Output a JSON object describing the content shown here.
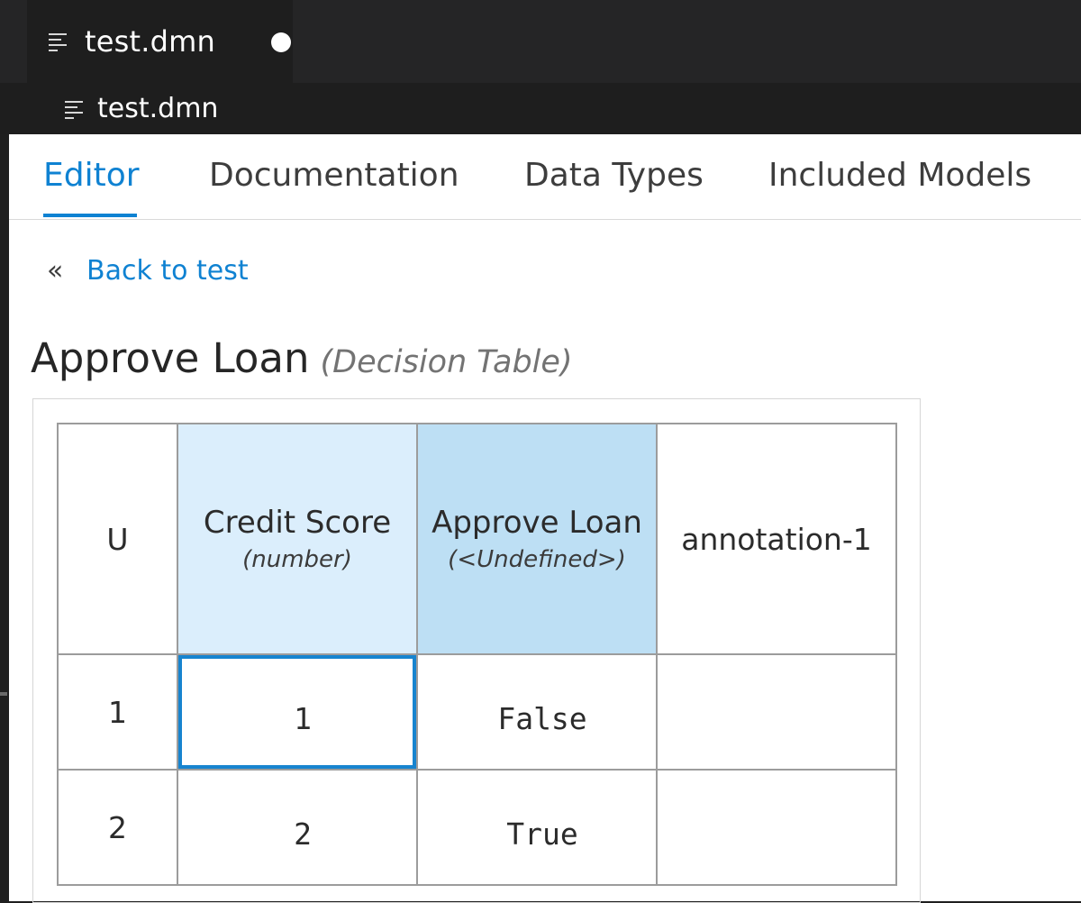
{
  "tab": {
    "title": "test.dmn",
    "icon": "lines-icon",
    "unsaved": true
  },
  "breadcrumb": {
    "icon": "lines-icon",
    "label": "test.dmn"
  },
  "navtabs": [
    {
      "label": "Editor",
      "active": true
    },
    {
      "label": "Documentation",
      "active": false
    },
    {
      "label": "Data Types",
      "active": false
    },
    {
      "label": "Included Models",
      "active": false
    }
  ],
  "back": {
    "icon": "double-chevron-left-icon",
    "label": "Back to test"
  },
  "decision": {
    "name": "Approve Loan",
    "kind": "(Decision Table)"
  },
  "table": {
    "hit_policy": "U",
    "input": {
      "name": "Credit Score",
      "type": "(number)"
    },
    "output": {
      "name": "Approve Loan",
      "type": "(<Undefined>)"
    },
    "annotation": "annotation-1",
    "rows": [
      {
        "num": "1",
        "input": "1",
        "output": "False",
        "annotation": ""
      },
      {
        "num": "2",
        "input": "2",
        "output": "True",
        "annotation": ""
      }
    ],
    "selected_cell": "row 1 input"
  },
  "colors": {
    "accent": "#0f82d2",
    "input_header": "#dbeefc",
    "output_header": "#bddff4",
    "selection": "#1784cf"
  }
}
